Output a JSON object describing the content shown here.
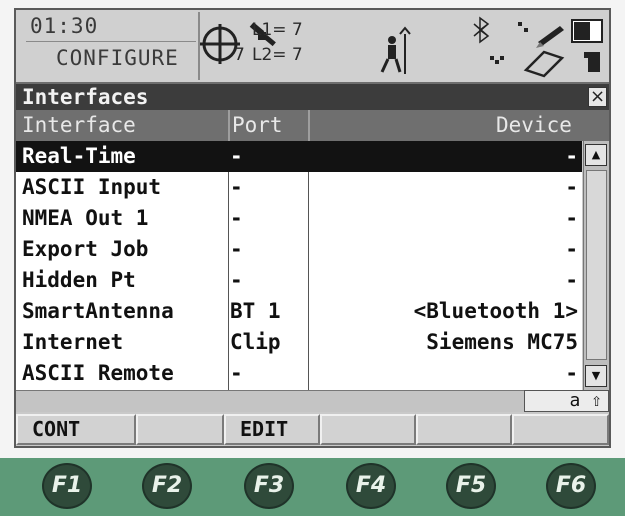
{
  "status_bar": {
    "time": "01:30",
    "mode": "CONFIGURE",
    "l1_label": "L1= 7",
    "l2_label": "L2= 7",
    "sat_count": "7",
    "icons": [
      "satellite-crosshair-icon",
      "satellite-icon",
      "surveyor-pole-icon",
      "bluetooth-icon",
      "network-icon",
      "pencil-icon",
      "card-icon",
      "battery-icon",
      "memory-icon"
    ]
  },
  "window": {
    "title": "Interfaces",
    "close_label": "×"
  },
  "table": {
    "columns": [
      "Interface",
      "Port",
      "Device"
    ],
    "rows": [
      {
        "interface": "Real-Time",
        "port": "-",
        "device": "-"
      },
      {
        "interface": "ASCII Input",
        "port": "-",
        "device": "-"
      },
      {
        "interface": "NMEA Out 1",
        "port": "-",
        "device": "-"
      },
      {
        "interface": "Export Job",
        "port": "-",
        "device": "-"
      },
      {
        "interface": "Hidden Pt",
        "port": "-",
        "device": "-"
      },
      {
        "interface": "SmartAntenna",
        "port": "BT 1",
        "device": "<Bluetooth 1>"
      },
      {
        "interface": "Internet",
        "port": "Clip",
        "device": "Siemens MC75"
      },
      {
        "interface": "ASCII Remote",
        "port": "-",
        "device": "-"
      }
    ],
    "selected_index": 0
  },
  "input_mode": "a ⇧",
  "softkeys": [
    "CONT",
    "",
    "EDIT",
    "",
    "",
    ""
  ],
  "function_keys": [
    "F1",
    "F2",
    "F3",
    "F4",
    "F5",
    "F6"
  ],
  "colors": {
    "title_bg": "#3c3c3c",
    "header_bg": "#6f6f6f",
    "selected_bg": "#121212",
    "fkey_strip": "#5d9a78"
  }
}
